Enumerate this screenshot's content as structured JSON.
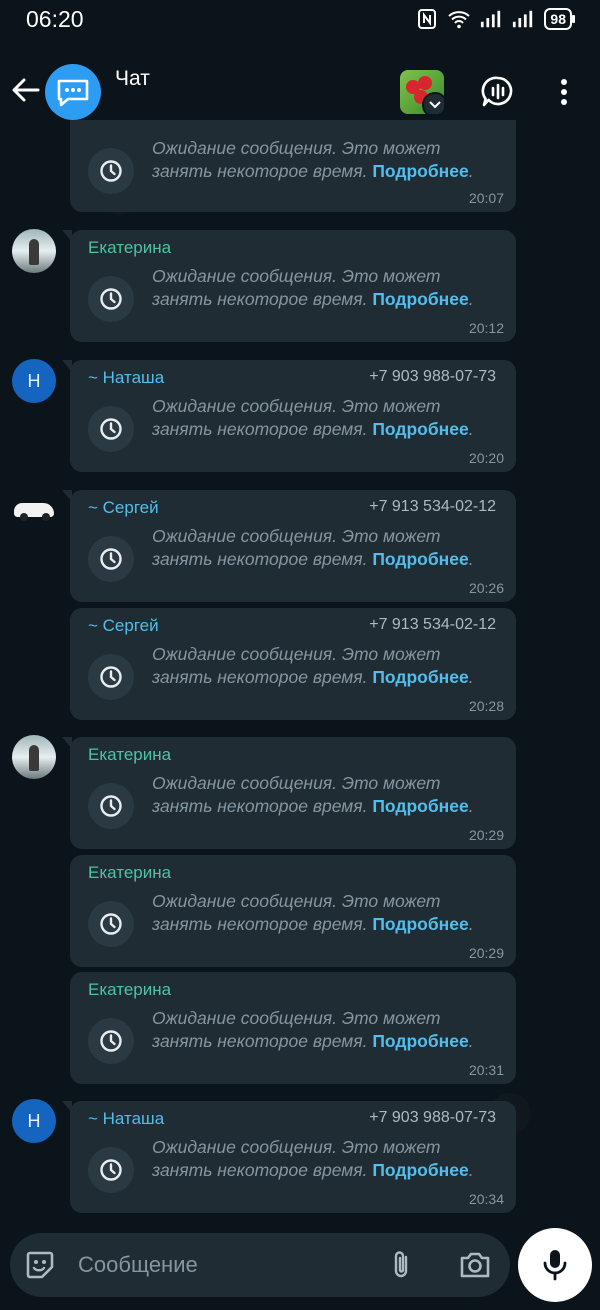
{
  "status_bar": {
    "time": "06:20",
    "battery": "98"
  },
  "header": {
    "title": "Чат"
  },
  "messages": [
    {
      "sender": "",
      "phone": "",
      "text_line1": "Ожидание сообщения. Это может",
      "text_line2": "занять некоторое время.",
      "more": "Подробнее",
      "time": "20:07"
    },
    {
      "sender": "Екатерина",
      "phone": "",
      "text_line1": "Ожидание сообщения. Это может",
      "text_line2": "занять некоторое время.",
      "more": "Подробнее",
      "time": "20:12"
    },
    {
      "sender": "~ Наташа",
      "phone": "+7 903 988-07-73",
      "avatar_letter": "Н",
      "text_line1": "Ожидание сообщения. Это может",
      "text_line2": "занять некоторое время.",
      "more": "Подробнее",
      "time": "20:20"
    },
    {
      "sender": "~ Сергей",
      "phone": "+7 913 534-02-12",
      "text_line1": "Ожидание сообщения. Это может",
      "text_line2": "занять некоторое время.",
      "more": "Подробнее",
      "time": "20:26"
    },
    {
      "sender": "~ Сергей",
      "phone": "+7 913 534-02-12",
      "text_line1": "Ожидание сообщения. Это может",
      "text_line2": "занять некоторое время.",
      "more": "Подробнее",
      "time": "20:28"
    },
    {
      "sender": "Екатерина",
      "phone": "",
      "text_line1": "Ожидание сообщения. Это может",
      "text_line2": "занять некоторое время.",
      "more": "Подробнее",
      "time": "20:29"
    },
    {
      "sender": "Екатерина",
      "phone": "",
      "text_line1": "Ожидание сообщения. Это может",
      "text_line2": "занять некоторое время.",
      "more": "Подробнее",
      "time": "20:29"
    },
    {
      "sender": "Екатерина",
      "phone": "",
      "text_line1": "Ожидание сообщения. Это может",
      "text_line2": "занять некоторое время.",
      "more": "Подробнее",
      "time": "20:31"
    },
    {
      "sender": "~ Наташа",
      "phone": "+7 903 988-07-73",
      "avatar_letter": "Н",
      "text_line1": "Ожидание сообщения. Это может",
      "text_line2": "занять некоторое время.",
      "more": "Подробнее",
      "time": "20:34"
    }
  ],
  "input": {
    "placeholder": "Сообщение"
  },
  "colors": {
    "background": "#0b141a",
    "bubble": "#1f2c34",
    "link": "#53bdeb",
    "sender_green": "#4fc3a1"
  }
}
